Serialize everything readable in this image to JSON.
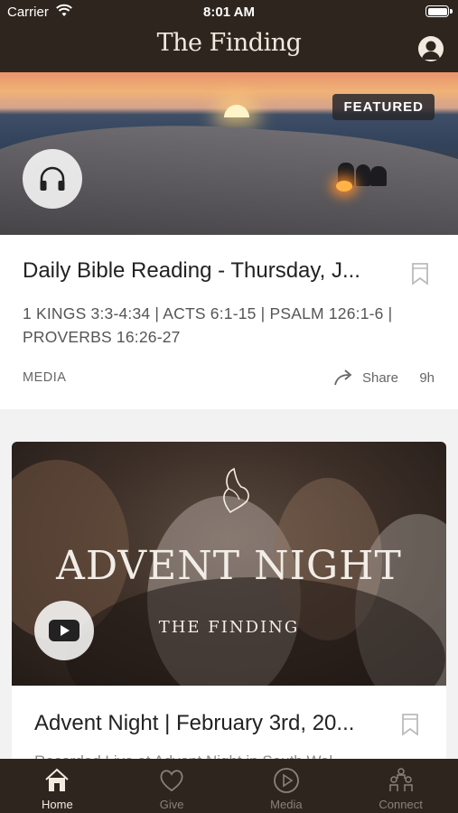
{
  "status_bar": {
    "carrier": "Carrier",
    "time": "8:01 AM"
  },
  "header": {
    "title": "The Finding",
    "profile_icon": "profile-icon"
  },
  "featured_card": {
    "badge": "FEATURED",
    "media_icon": "headphones-icon",
    "title": "Daily Bible Reading - Thursday, J...",
    "subtitle": "1 KINGS 3:3-4:34 | ACTS 6:1-15 | PSALM 126:1-6 | PROVERBS 16:26-27",
    "category": "MEDIA",
    "share_label": "Share",
    "age": "9h"
  },
  "second_card": {
    "image_title": "ADVENT NIGHT",
    "image_subtitle": "THE FINDING",
    "media_icon": "play-video-icon",
    "title": "Advent Night | February 3rd, 20...",
    "subtitle": "Recorded Live at Advent Night in South Wal..."
  },
  "tabs": [
    {
      "label": "Home",
      "icon": "home-icon",
      "active": true
    },
    {
      "label": "Give",
      "icon": "heart-icon",
      "active": false
    },
    {
      "label": "Media",
      "icon": "play-circle-icon",
      "active": false
    },
    {
      "label": "Connect",
      "icon": "people-icon",
      "active": false
    }
  ],
  "colors": {
    "bar": "#2e261e",
    "bar_text": "#f3eadf",
    "inactive_tab": "#8a8277"
  }
}
